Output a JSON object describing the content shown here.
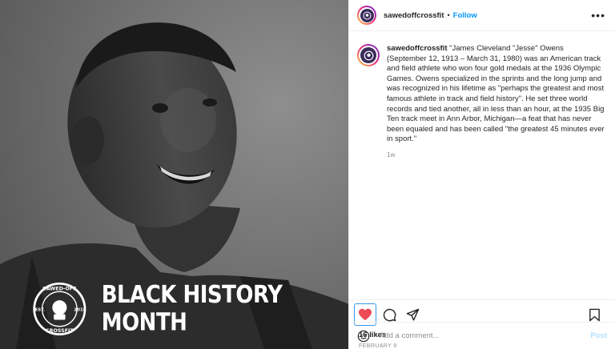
{
  "post": {
    "image_overlay_text": "BLACK HISTORY MONTH",
    "badge": {
      "top": "SAWED-OFF",
      "bottom": "CROSSFIT",
      "left": "EST.",
      "right": "2016"
    }
  },
  "header": {
    "username": "sawedoffcrossfit",
    "separator": "•",
    "follow_label": "Follow",
    "more_icon": "more-options-icon"
  },
  "caption": {
    "username": "sawedoffcrossfit",
    "text": "\"James Cleveland \"Jesse\" Owens (September 12, 1913 – March 31, 1980) was an American track and field athlete who won four gold medals at the 1936 Olympic Games. Owens specialized in the sprints and the long jump and was recognized in his lifetime as \"perhaps the greatest and most famous athlete in track and field history\". He set three world records and tied another, all in less than an hour, at the 1935 Big Ten track meet in Ann Arbor, Michigan—a feat that has never been equaled and has been called \"the greatest 45 minutes ever in sport.\"",
    "time": "1w"
  },
  "actions": {
    "like_icon": "heart-filled-icon",
    "comment_icon": "comment-icon",
    "share_icon": "share-icon",
    "save_icon": "bookmark-icon",
    "liked_color": "#ed4956"
  },
  "stats": {
    "likes": "16 likes",
    "date": "FEBRUARY 9"
  },
  "comment_box": {
    "emoji_icon": "emoji-icon",
    "placeholder": "Add a comment...",
    "post_label": "Post"
  }
}
